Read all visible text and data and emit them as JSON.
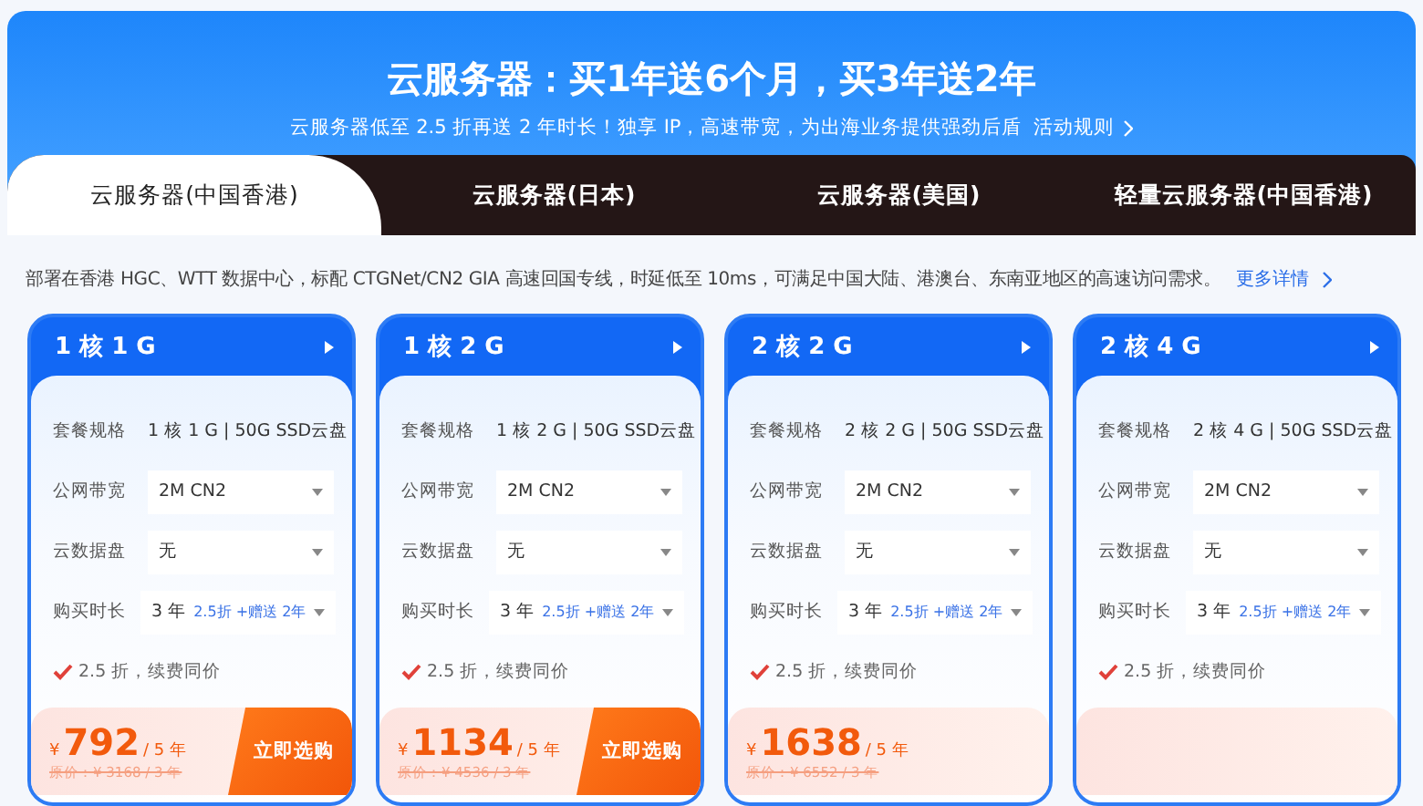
{
  "banner": {
    "title": "云服务器：买1年送6个月，买3年送2年",
    "subtitle": "云服务器低至 2.5 折再送 2 年时长！独享 IP，高速带宽，为出海业务提供强劲后盾",
    "rules_link": "活动规则"
  },
  "tabs": [
    {
      "label": "云服务器(中国香港)",
      "selected": true
    },
    {
      "label": "云服务器(日本)",
      "selected": false
    },
    {
      "label": "云服务器(美国)",
      "selected": false
    },
    {
      "label": "轻量云服务器(中国香港)",
      "selected": false
    }
  ],
  "description": {
    "text": "部署在香港 HGC、WTT 数据中心，标配 CTGNet/CN2 GIA 高速回国专线，时延低至 10ms，可满足中国大陆、港澳台、东南亚地区的高速访问需求。",
    "link": "更多详情"
  },
  "cards": [
    {
      "title": "1 核 1 G",
      "rows": [
        {
          "kind": "text",
          "label": "套餐规格",
          "value": "1 核 1 G | 50G SSD云盘"
        },
        {
          "kind": "select",
          "label": "公网带宽",
          "value": "2M CN2"
        },
        {
          "kind": "select",
          "label": "云数据盘",
          "value": "无"
        },
        {
          "kind": "select",
          "label": "购买时长",
          "value": "3 年",
          "promo": "2.5折 +赠送 2年"
        }
      ],
      "note": "2.5 折，续费同价",
      "price": {
        "currency": "¥",
        "amount": "792",
        "unit": "/ 5 年",
        "original": "原价：¥ 3168 / 3 年"
      },
      "buy_button": "立即选购"
    },
    {
      "title": "1 核 2 G",
      "rows": [
        {
          "kind": "text",
          "label": "套餐规格",
          "value": "1 核 2 G | 50G SSD云盘"
        },
        {
          "kind": "select",
          "label": "公网带宽",
          "value": "2M CN2"
        },
        {
          "kind": "select",
          "label": "云数据盘",
          "value": "无"
        },
        {
          "kind": "select",
          "label": "购买时长",
          "value": "3 年",
          "promo": "2.5折 +赠送 2年"
        }
      ],
      "note": "2.5 折，续费同价",
      "price": {
        "currency": "¥",
        "amount": "1134",
        "unit": "/ 5 年",
        "original": "原价：¥ 4536 / 3 年"
      },
      "buy_button": "立即选购"
    },
    {
      "title": "2 核 2 G",
      "rows": [
        {
          "kind": "text",
          "label": "套餐规格",
          "value": "2 核 2 G | 50G SSD云盘"
        },
        {
          "kind": "select",
          "label": "公网带宽",
          "value": "2M CN2"
        },
        {
          "kind": "select",
          "label": "云数据盘",
          "value": "无"
        },
        {
          "kind": "select",
          "label": "购买时长",
          "value": "3 年",
          "promo": "2.5折 +赠送 2年"
        }
      ],
      "note": "2.5 折，续费同价",
      "price": {
        "currency": "¥",
        "amount": "1638",
        "unit": "/ 5 年",
        "original": "原价：¥ 6552 / 3 年"
      }
    },
    {
      "title": "2 核 4 G",
      "rows": [
        {
          "kind": "text",
          "label": "套餐规格",
          "value": "2 核 4 G | 50G SSD云盘"
        },
        {
          "kind": "select",
          "label": "公网带宽",
          "value": "2M CN2"
        },
        {
          "kind": "select",
          "label": "云数据盘",
          "value": "无"
        },
        {
          "kind": "select",
          "label": "购买时长",
          "value": "3 年",
          "promo": "2.5折 +赠送 2年"
        }
      ],
      "note": "2.5 折，续费同价"
    }
  ]
}
